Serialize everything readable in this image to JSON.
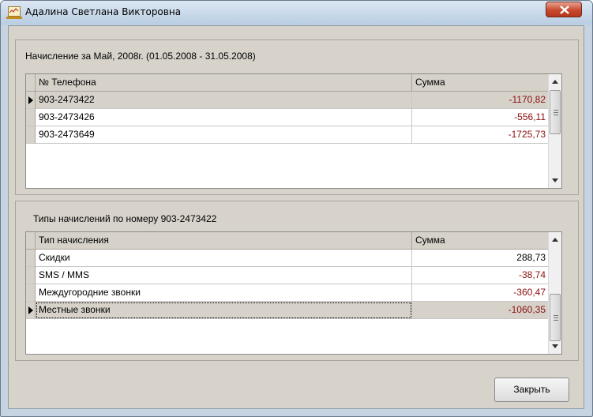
{
  "window": {
    "title": "Адалина Светлана Викторовна",
    "close_glyph": "X"
  },
  "charges": {
    "caption": "Начисление за Май, 2008г. (01.05.2008 - 31.05.2008)",
    "columns": [
      "№ Телефона",
      "Сумма"
    ],
    "rows": [
      {
        "phone": "903-2473422",
        "sum": "-1170,82",
        "selected": true
      },
      {
        "phone": "903-2473426",
        "sum": "-556,11",
        "selected": false
      },
      {
        "phone": "903-2473649",
        "sum": "-1725,73",
        "selected": false
      }
    ]
  },
  "types": {
    "caption": "Типы начислений по номеру 903-2473422",
    "columns": [
      "Тип начисления",
      "Сумма"
    ],
    "rows": [
      {
        "type": "Скидки",
        "sum": "288,73",
        "selected": false
      },
      {
        "type": "SMS / MMS",
        "sum": "-38,74",
        "selected": false
      },
      {
        "type": "Междугородние звонки",
        "sum": "-360,47",
        "selected": false
      },
      {
        "type": "Местные звонки",
        "sum": "-1060,35",
        "selected": true
      }
    ]
  },
  "footer": {
    "close_label": "Закрыть"
  },
  "colors": {
    "negative": "#8b0f0f",
    "positive": "#000000",
    "selected_row": "#d6d2ca"
  },
  "icons": {
    "row_indicator": "triangle-right-icon",
    "scroll_up": "arrow-up-icon",
    "scroll_down": "arrow-down-icon",
    "window_close": "close-icon",
    "app": "app-window-icon"
  }
}
